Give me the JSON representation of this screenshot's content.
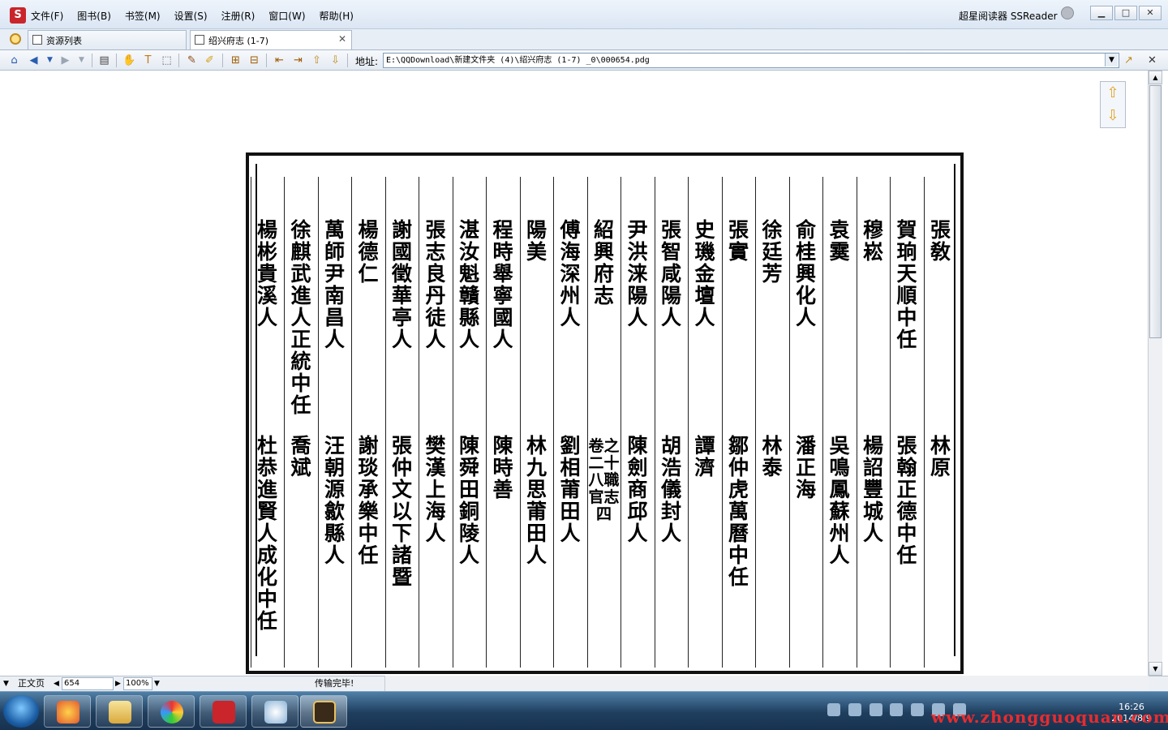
{
  "app": {
    "title": "超星阅读器 SSReader"
  },
  "menu": [
    "文件(F)",
    "图书(B)",
    "书签(M)",
    "设置(S)",
    "注册(R)",
    "窗口(W)",
    "帮助(H)"
  ],
  "tabs": [
    {
      "label": "资源列表"
    },
    {
      "label": "绍兴府志 (1-7)"
    }
  ],
  "address": {
    "label": "地址:",
    "value": "E:\\QQDownload\\新建文件夹 (4)\\绍兴府志 (1-7) _0\\000654.pdg"
  },
  "document": {
    "columns": [
      {
        "top": "張　敎",
        "bottom": "林　原"
      },
      {
        "top": "賀　珦天順中任",
        "bottom": "張　翰正德中任"
      },
      {
        "top": "穆　崧",
        "bottom": "楊　詔豐城人"
      },
      {
        "top": "袁　霙",
        "bottom": "吳鳴鳳蘇州人"
      },
      {
        "top": "俞　桂興化人",
        "bottom": "潘正海"
      },
      {
        "top": "徐廷芳",
        "bottom": "林　泰"
      },
      {
        "top": "張　實",
        "bottom": "鄒仲虎萬曆中任"
      },
      {
        "top": "史　璣金壇人",
        "bottom": "譚　濟"
      },
      {
        "top": "張　智咸陽人",
        "bottom": "胡　浩儀封人"
      },
      {
        "top": "尹　洪涞陽人",
        "bottom": "陳　劍商邱人"
      },
      {
        "top": "紹興府志",
        "middle": "卷之二十八職官志四"
      },
      {
        "top": "傅　海深州人",
        "bottom": "劉　相莆田人"
      },
      {
        "top": "陽　美",
        "bottom": "林九思莆田人"
      },
      {
        "top": "程時舉寧國人",
        "bottom": "陳時善"
      },
      {
        "top": "湛汝魁贛縣人",
        "bottom": "陳舜田銅陵人"
      },
      {
        "top": "張志良丹徒人",
        "bottom": "樊　漢上海人"
      },
      {
        "top": "謝國徵華亭人",
        "bottom": "張仲文以下諸暨"
      },
      {
        "top": "楊德仁",
        "bottom": "謝　琰承樂中任"
      },
      {
        "top": "萬師尹南昌人",
        "bottom": "汪朝源歙縣人"
      },
      {
        "top": "徐　麒武進人正統中任",
        "bottom": "喬　斌"
      },
      {
        "top": "楊　彬貴溪人",
        "bottom": "杜　恭進賢人成化中任"
      }
    ]
  },
  "status": {
    "view_mode": "正文页",
    "page": "654",
    "zoom": "100%",
    "message": "传输完毕!"
  },
  "taskbar": {
    "time": "16:26",
    "date": "2014/8/9"
  },
  "watermark": "www.zhongguoquan.com",
  "colors": {
    "accent": "#c9252b",
    "taskbar": "#1f3e5e"
  }
}
